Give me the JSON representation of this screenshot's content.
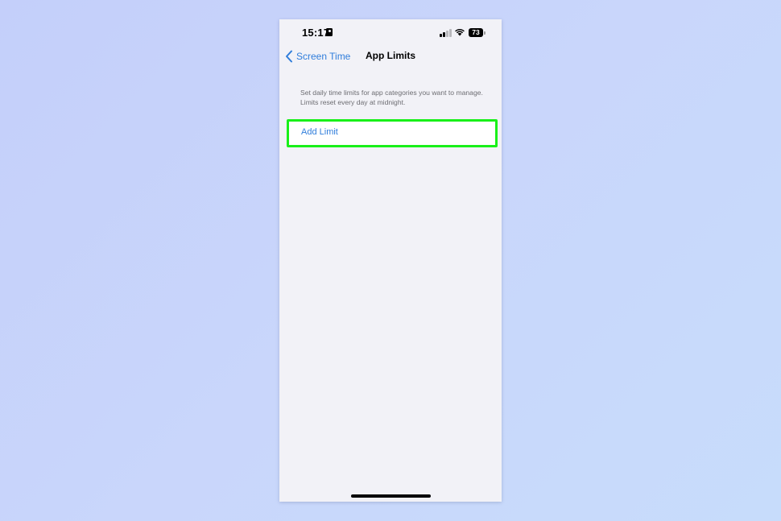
{
  "status_bar": {
    "time": "15:17",
    "battery_level": "73",
    "icons": [
      "focus-icon",
      "signal-icon",
      "wifi-icon",
      "battery-icon"
    ]
  },
  "nav": {
    "back_label": "Screen Time",
    "title": "App Limits"
  },
  "content": {
    "description": "Set daily time limits for app categories you want to manage. Limits reset every day at midnight.",
    "add_limit_label": "Add Limit"
  },
  "colors": {
    "accent": "#2f7ddb",
    "highlight": "#19f019",
    "background": "#f2f2f7"
  }
}
